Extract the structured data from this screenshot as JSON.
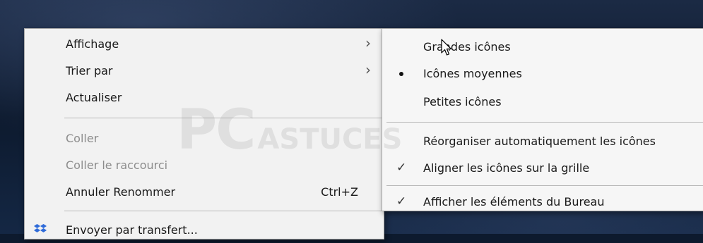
{
  "main_menu": {
    "items": [
      {
        "label": "Affichage",
        "has_submenu": true
      },
      {
        "label": "Trier par",
        "has_submenu": true
      },
      {
        "label": "Actualiser"
      },
      {
        "label": "Coller",
        "disabled": true
      },
      {
        "label": "Coller le raccourci",
        "disabled": true
      },
      {
        "label": "Annuler Renommer",
        "shortcut": "Ctrl+Z"
      },
      {
        "label": "Envoyer par transfert...",
        "icon": "dropbox-icon"
      }
    ]
  },
  "sub_menu": {
    "items": [
      {
        "label": "Grandes icônes"
      },
      {
        "label": "Icônes moyennes",
        "marker": "bullet"
      },
      {
        "label": "Petites icônes"
      },
      {
        "label": "Réorganiser automatiquement les icônes"
      },
      {
        "label": "Aligner les icônes sur la grille",
        "marker": "check"
      },
      {
        "label": "Afficher les éléments du Bureau",
        "marker": "check"
      }
    ]
  },
  "watermark": {
    "big": "PC",
    "small": "ASTUCES"
  },
  "colors": {
    "menu_bg": "#f2f2f2",
    "submenu_bg": "#f6f6f6",
    "disabled_text": "#8c8c8c",
    "dropbox_blue": "#2f6bd9"
  }
}
